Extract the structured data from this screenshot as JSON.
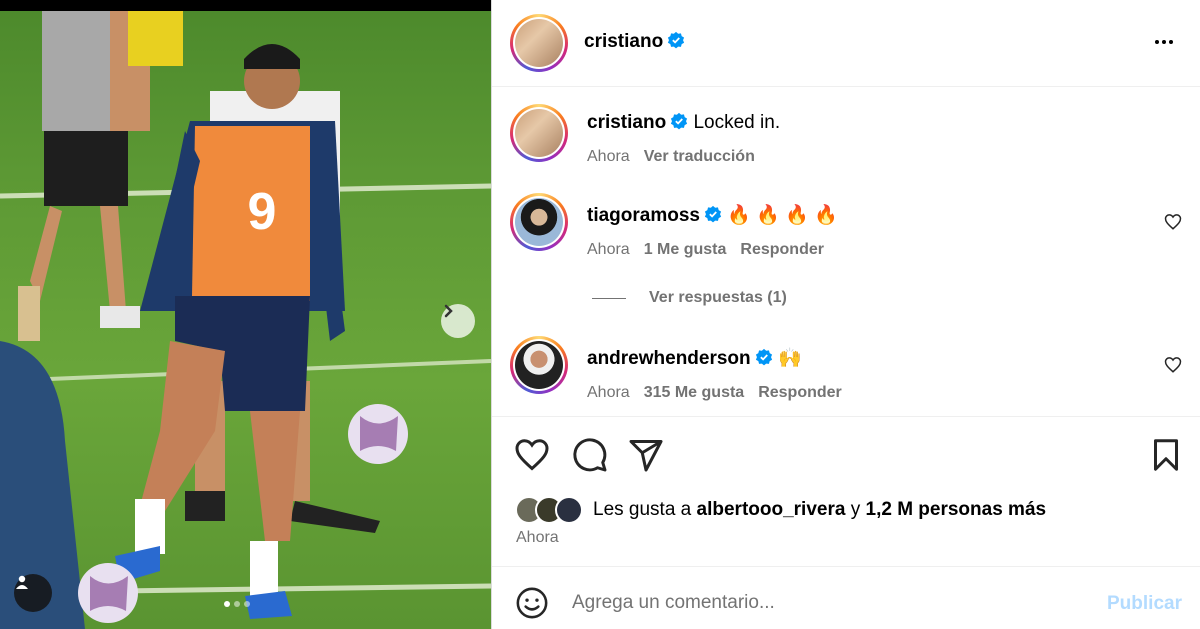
{
  "post": {
    "author": "cristiano",
    "dots": 3
  },
  "caption": {
    "username": "cristiano",
    "text": "Locked in.",
    "time": "Ahora",
    "translate": "Ver traducción"
  },
  "comments": [
    {
      "username": "tiagoramoss",
      "text": "🔥 🔥 🔥 🔥",
      "time": "Ahora",
      "likes": "1 Me gusta",
      "reply": "Responder"
    },
    {
      "username": "andrewhenderson",
      "text": "🙌",
      "time": "Ahora",
      "likes": "315 Me gusta",
      "reply": "Responder"
    }
  ],
  "replies_link": "Ver respuestas (1)",
  "likes": {
    "prefix": "Les gusta a",
    "user": "albertooo_rivera",
    "and": "y",
    "rest": "1,2 M personas más"
  },
  "post_time": "Ahora",
  "compose": {
    "placeholder": "Agrega un comentario...",
    "publish": "Publicar"
  },
  "photo": {
    "bib_number": "9"
  },
  "colors": {
    "verified": "#0095f6",
    "muted": "#737373",
    "publish_disabled": "#b3dbff"
  },
  "icons": [
    "verified-icon",
    "more-options-icon",
    "heart-icon",
    "comment-icon",
    "share-icon",
    "bookmark-icon",
    "emoji-icon",
    "chevron-right-icon",
    "user-tag-icon"
  ]
}
